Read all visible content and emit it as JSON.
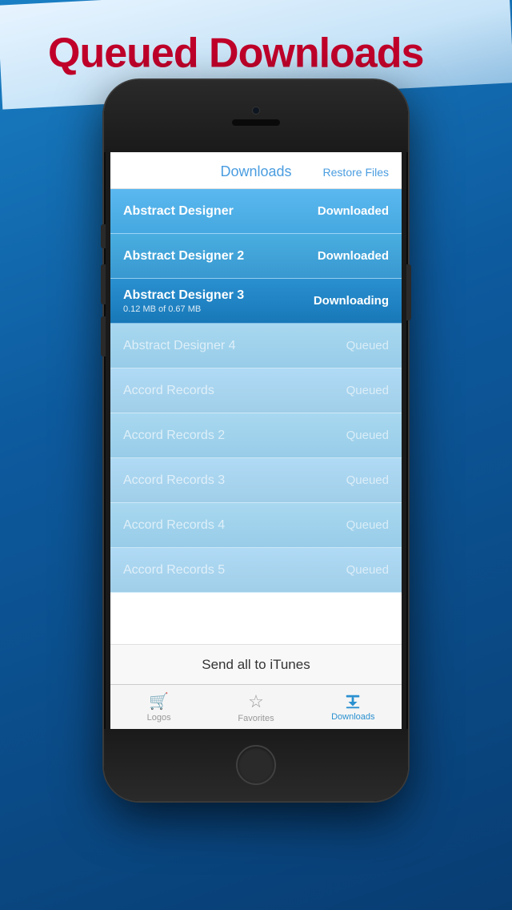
{
  "banner": {
    "text": "Queued Downloads"
  },
  "screen": {
    "header": {
      "title_bold": "Download",
      "title_light": "s",
      "restore_label": "Restore Files"
    },
    "items": [
      {
        "name": "Abstract Designer",
        "status": "Downloaded",
        "type": "downloaded",
        "subtext": ""
      },
      {
        "name": "Abstract Designer 2",
        "status": "Downloaded",
        "type": "downloaded",
        "subtext": ""
      },
      {
        "name": "Abstract Designer 3",
        "status": "Downloading",
        "type": "downloading",
        "subtext": "0.12 MB of 0.67 MB"
      },
      {
        "name": "Abstract Designer 4",
        "status": "Queued",
        "type": "queued",
        "subtext": ""
      },
      {
        "name": "Accord Records",
        "status": "Queued",
        "type": "queued",
        "subtext": ""
      },
      {
        "name": "Accord Records 2",
        "status": "Queued",
        "type": "queued",
        "subtext": ""
      },
      {
        "name": "Accord Records 3",
        "status": "Queued",
        "type": "queued",
        "subtext": ""
      },
      {
        "name": "Accord Records 4",
        "status": "Queued",
        "type": "queued",
        "subtext": ""
      },
      {
        "name": "Accord Records 5",
        "status": "Queued",
        "type": "queued",
        "subtext": ""
      }
    ],
    "send_itunes_label": "Send all to iTunes",
    "tabs": [
      {
        "id": "logos",
        "label": "Logos",
        "icon": "cart",
        "active": false
      },
      {
        "id": "favorites",
        "label": "Favorites",
        "icon": "star",
        "active": false
      },
      {
        "id": "downloads",
        "label": "Downloads",
        "icon": "download",
        "active": true
      }
    ]
  }
}
